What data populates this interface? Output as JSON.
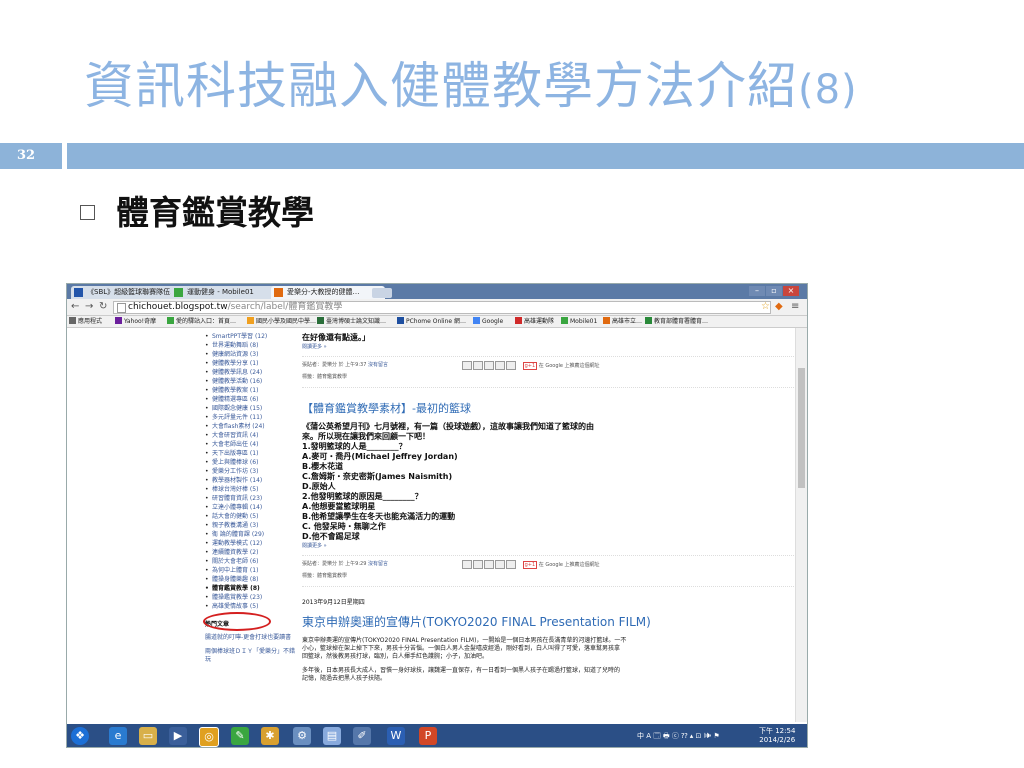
{
  "slide": {
    "title": "資訊科技融入健體教學方法介紹",
    "title_num": "(8)",
    "page_number": "32",
    "bullet": "體育鑑賞教學"
  },
  "browser": {
    "tabs": [
      {
        "label": "《SBL》超級籃球聯賽隊伍…",
        "color": "#2255aa"
      },
      {
        "label": "運動健身 - Mobile01",
        "color": "#3aa640"
      },
      {
        "label": "愛樂分-大教授的健體…",
        "color": "#e06a10"
      }
    ],
    "url_host": "chichouet.blogspot.tw",
    "url_path": "/search/label/體育鑑賞教學",
    "bookmarks": [
      {
        "label": "應用程式",
        "color": "#666666"
      },
      {
        "label": "Yahoo!奇摩",
        "color": "#6b1f9c"
      },
      {
        "label": "愛的驛站入口：首頁…",
        "color": "#3aa640"
      },
      {
        "label": "國民小學及國民中學…",
        "color": "#f0a020"
      },
      {
        "label": "臺灣博碩士論文知識…",
        "color": "#2a6e3a"
      },
      {
        "label": "PChome Online 網…",
        "color": "#1e4fa0"
      },
      {
        "label": "Google",
        "color": "#4285f4"
      },
      {
        "label": "高雄運動隊",
        "color": "#d02a2a"
      },
      {
        "label": "Mobile01",
        "color": "#3aa640"
      },
      {
        "label": "高雄市立…",
        "color": "#e06a10"
      },
      {
        "label": "教育部體育署體育…",
        "color": "#2a8a3a"
      }
    ]
  },
  "sidebar": {
    "items": [
      {
        "label": "SmartPPT學習 (12)"
      },
      {
        "label": "世界運動舞蹈 (8)"
      },
      {
        "label": "健康網站資源 (3)"
      },
      {
        "label": "健體教學分享 (1)"
      },
      {
        "label": "健體教學訊息 (24)"
      },
      {
        "label": "健體教學活動 (16)"
      },
      {
        "label": "健體教學教案 (1)"
      },
      {
        "label": "健體精選專區 (6)"
      },
      {
        "label": "國際觀念健康 (15)"
      },
      {
        "label": "多元評量元件 (11)"
      },
      {
        "label": "大會flash素材 (24)"
      },
      {
        "label": "大會研習資訊 (4)"
      },
      {
        "label": "大會老師出任 (4)"
      },
      {
        "label": "天下出版專區 (1)"
      },
      {
        "label": "愛上與體棒球 (6)"
      },
      {
        "label": "愛樂分工作坊 (3)"
      },
      {
        "label": "教學器材製作 (14)"
      },
      {
        "label": "棒球台灣好棒 (5)"
      },
      {
        "label": "研習體育資訊 (23)"
      },
      {
        "label": "立達小體專輯 (14)"
      },
      {
        "label": "話大會的健動 (5)"
      },
      {
        "label": "親子教養溝通 (3)"
      },
      {
        "label": "衛 論的體育課 (29)"
      },
      {
        "label": "運動教學模式 (12)"
      },
      {
        "label": "連續體資教學 (2)"
      },
      {
        "label": "關於大會老師 (6)"
      },
      {
        "label": "為何中上體育 (1)"
      },
      {
        "label": "體操身體樂趣 (8)"
      },
      {
        "label": "體育鑑賞教學 (8)"
      },
      {
        "label": "體操鑑賞教學 (23)"
      },
      {
        "label": "高雄愛情故事 (5)"
      }
    ],
    "hot_title": "熱門文章",
    "hot_links": [
      "腸道就的叮嚀-更會打球也要讀書",
      "兩個棒球班ＤＩＹ「愛樂分」不錯玩"
    ]
  },
  "main": {
    "top_text": "在好像還有點遠。」",
    "read_more": "閱讀更多 »",
    "share1": {
      "posted": "張貼者：愛樂分 於 上午9:37",
      "comment": "沒有留言",
      "tags": "標籤：體育鑑賞教學"
    },
    "gplus_label": "g+1",
    "gplus_note": "在 Google 上推薦這個網址",
    "post_title": "【體育鑑賞教學素材】-最初的籃球",
    "body_lines": [
      "《蒲公英希望月刊》七月號裡，有一篇（投球遊戲），這故事讓我們知道了籃球的由",
      "來。所以現在讓我們來回顧一下吧！",
      "1.發明籃球的人是________？",
      "A.麥可・喬丹(Michael Jeffrey Jordan)",
      "B.櫻木花道",
      "C.詹姆斯・奈史密斯(James Naismith)",
      "D.原始人",
      "2.他發明籃球的原因是________？",
      "A.他想要當籃球明星",
      "B.他希望讓學生在冬天也能充滿活力的運動",
      "C. 他發呆時・無聊之作",
      "D.他不會踢足球"
    ],
    "share2": {
      "posted": "張貼者：愛樂分 於 上午9:29",
      "comment": "沒有留言",
      "tags": "標籤：體育鑑賞教學"
    },
    "date": "2013年9月12日星期四",
    "post_title2": "東京申辦奧運的宣傳片(TOKYO2020 FINAL Presentation FILM)",
    "tokyo_lines": [
      "東京申辦奧運的宣傳片(TOKYO2020 FINAL Presentation FILM)，一開始是一個日本男孩在長滿青草的河邊打籃球。一不",
      "小心，籃球掉在架上掉下下來，男孩十分苦惱。一個白人男人金髮嘻皮經過，剛好看到，白人叫得了可愛，落車幫男孩拿",
      "回籃球，然後教男孩打球，臨別，白人揮手紅色護腕；小子，加油吧。",
      "",
      "多年後，日本男孩長大成人，習慣一身好球技，讓魏運一直保存，有一日看到一個黑人孩子在踢過打籃球，知道了兒時的",
      "記憶，隨過去把黑人孩子扶隨。"
    ]
  },
  "taskbar": {
    "tray_text": "中 A 🗔 🖶 ⓒ ⁇ ▴ ⊡ 🕪 ⚑",
    "time": "下午 12:54",
    "date": "2014/2/26"
  },
  "colors": {
    "title_blue": "#8db4e2",
    "band_blue": "#8db3d9",
    "link_blue": "#2f6bb5",
    "highlight_red": "#d42020"
  }
}
